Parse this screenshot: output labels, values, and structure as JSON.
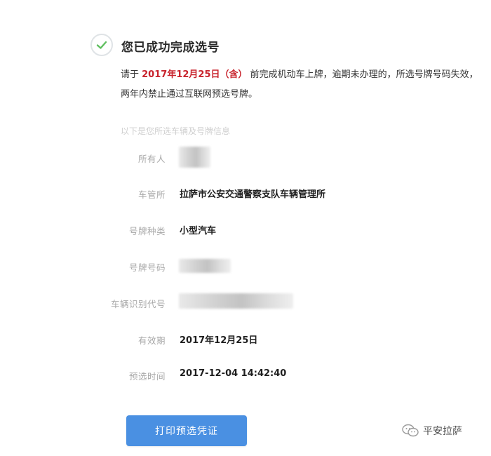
{
  "header": {
    "title": "您已成功完成选号",
    "check_icon": "check-circle-icon"
  },
  "notice": {
    "prefix": "请于 ",
    "deadline": "2017年12月25日（含）",
    "suffix": " 前完成机动车上牌，逾期未办理的，所选号牌号码失效，两年内禁止通过互联网预选号牌。"
  },
  "section_hint": "以下是您所选车辆及号牌信息",
  "fields": {
    "owner_label": "所有人",
    "office_label": "车管所",
    "office_value": "拉萨市公安交通警察支队车辆管理所",
    "plate_type_label": "号牌种类",
    "plate_type_value": "小型汽车",
    "plate_number_label": "号牌号码",
    "vin_label": "车辆识别代号",
    "validity_label": "有效期",
    "validity_value": "2017年12月25日",
    "time_label": "预选时间",
    "time_value": "2017-12-04 14:42:40"
  },
  "button": {
    "print_label": "打印预选凭证"
  },
  "watermark": {
    "text": "平安拉萨",
    "icon": "wechat-icon"
  },
  "colors": {
    "accent": "#4a90e2",
    "deadline": "#c8232c",
    "check": "#5fbf5f"
  }
}
